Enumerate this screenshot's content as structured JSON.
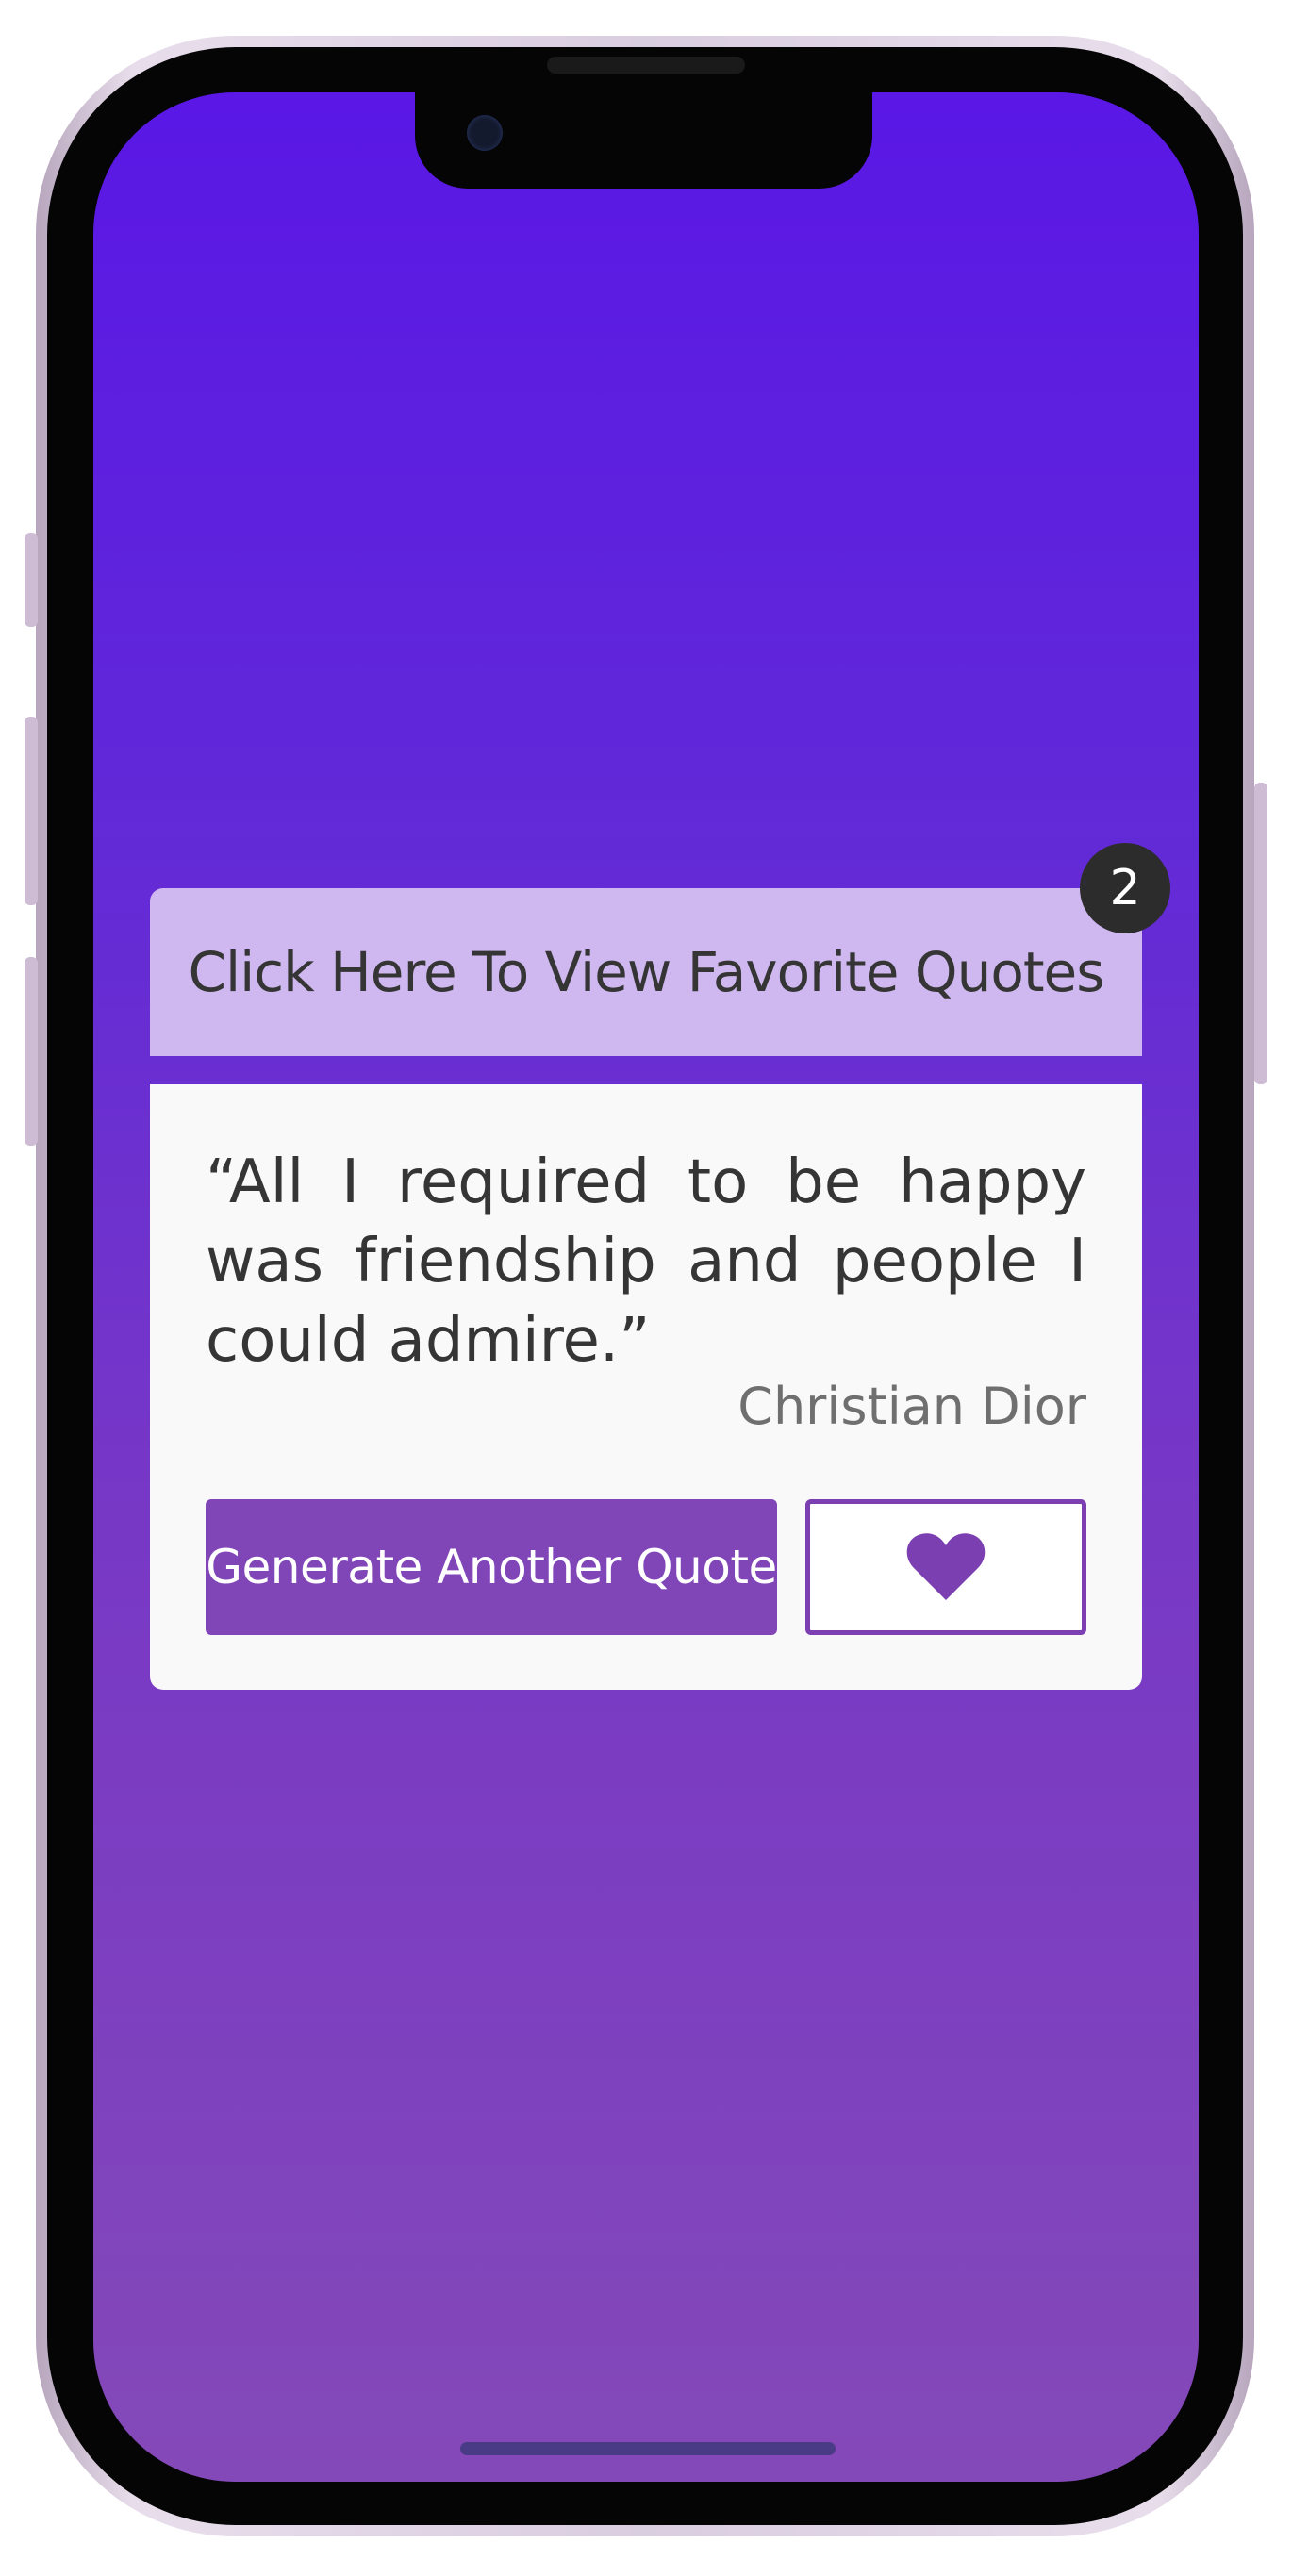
{
  "favorites": {
    "header_label": "Click Here To View Favorite Quotes",
    "count": "2"
  },
  "quote": {
    "text": "“All I required to be happy was friendship and people I could admire.”",
    "author": "Christian Dior"
  },
  "actions": {
    "generate_label": "Generate Another Quote",
    "favorite_icon": "heart-icon"
  },
  "colors": {
    "gradient_top": "#5a17e6",
    "gradient_bottom": "#8449b8",
    "header_bg": "#cfb8ef",
    "button_primary": "#8046b8",
    "badge_bg": "#2c2c2c"
  }
}
